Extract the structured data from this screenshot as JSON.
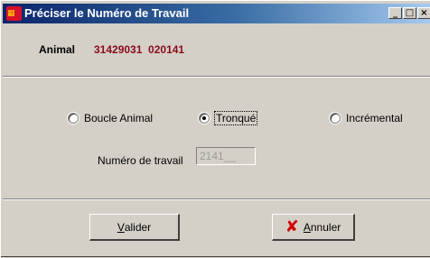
{
  "window": {
    "title": "Préciser le Numéro de Travail"
  },
  "titlebar_buttons": {
    "minimize": "_",
    "maximize": "□",
    "close": "×"
  },
  "animal": {
    "label": "Animal",
    "value": "31429031  020141"
  },
  "options": [
    {
      "label": "Boucle Animal",
      "checked": false
    },
    {
      "label": "Tronqué",
      "checked": true
    },
    {
      "label": "Incrémental",
      "checked": false
    }
  ],
  "numero": {
    "label": "Numéro de travail",
    "value": "2141__"
  },
  "buttons": {
    "valider_u": "V",
    "valider_rest": "alider",
    "annuler_icon": "✘",
    "annuler_u": "A",
    "annuler_rest": "nnuler"
  },
  "colors": {
    "title_start": "#0a246a",
    "title_end": "#a6caf0",
    "animal_value": "#8b0a1a",
    "annuler_icon": "#d00000"
  }
}
